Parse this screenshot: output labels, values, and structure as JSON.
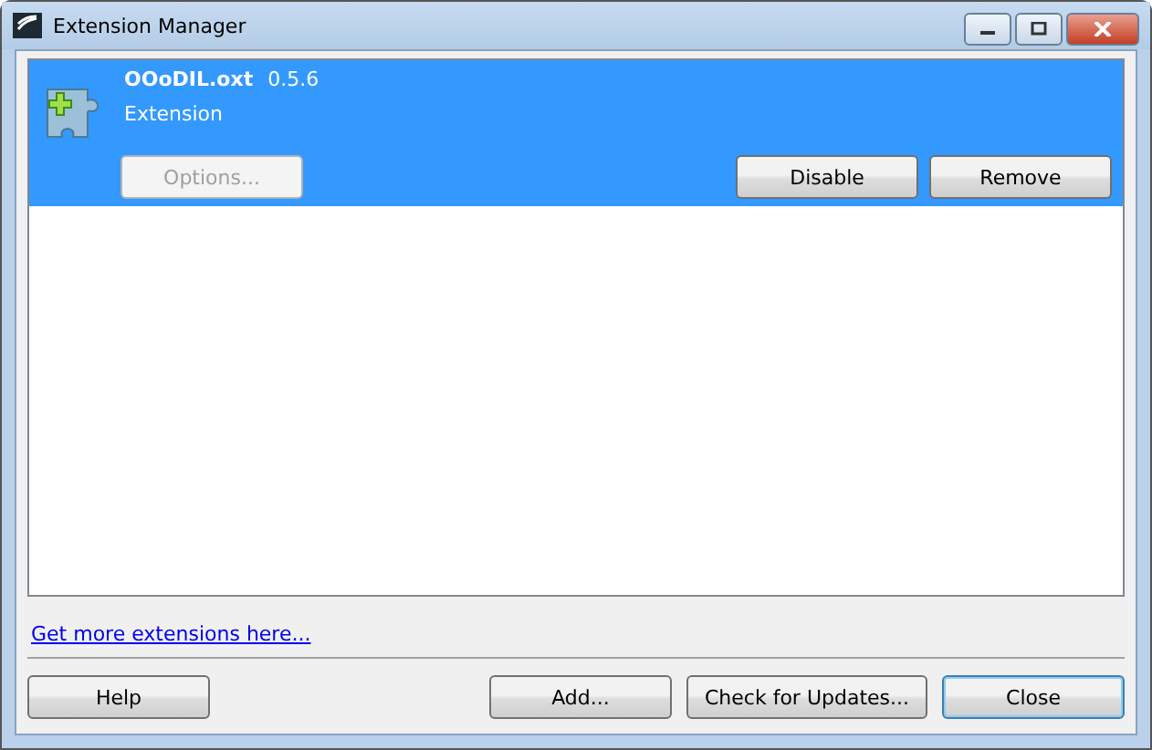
{
  "window": {
    "title": "Extension Manager"
  },
  "extensions": [
    {
      "name": "OOoDIL.oxt",
      "version": "0.5.6",
      "description": "Extension",
      "selected": true,
      "options": {
        "label": "Options...",
        "disabled": true
      },
      "actions": [
        {
          "label": "Disable"
        },
        {
          "label": "Remove"
        }
      ]
    }
  ],
  "link": "Get more extensions here...",
  "left_buttons": [
    {
      "label": "Help",
      "default": false
    }
  ],
  "right_buttons": [
    {
      "label": "Add...",
      "default": false
    },
    {
      "label": "Check for Updates...",
      "default": false
    },
    {
      "label": "Close",
      "default": true
    }
  ]
}
